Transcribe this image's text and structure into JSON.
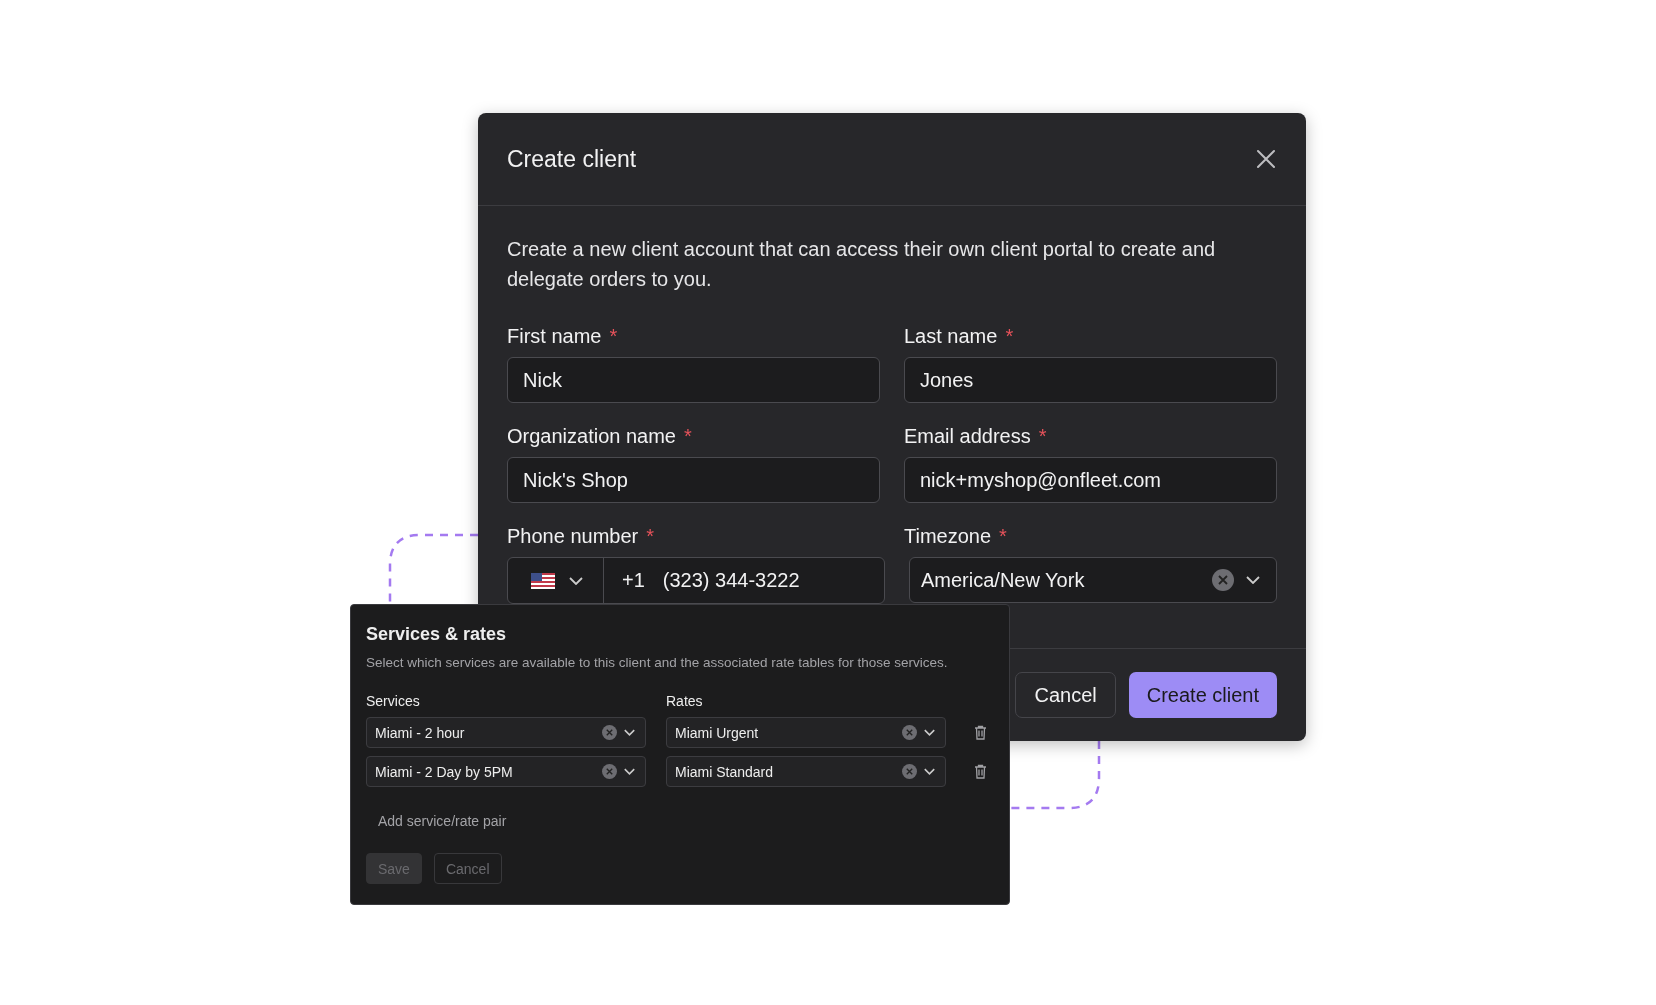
{
  "dialog": {
    "title": "Create client",
    "description": "Create a new client account that can access their own client portal to create and delegate orders to you.",
    "fields": [
      {
        "kind": "text",
        "label": "First name",
        "required_mark": "*",
        "value": "Nick"
      },
      {
        "kind": "text",
        "label": "Last name",
        "required_mark": "*",
        "value": "Jones"
      },
      {
        "kind": "text",
        "label": "Organization name",
        "required_mark": "*",
        "value": "Nick's Shop"
      },
      {
        "kind": "text",
        "label": "Email address",
        "required_mark": "*",
        "value": "nick+myshop@onfleet.com"
      },
      {
        "kind": "phone",
        "label": "Phone number",
        "required_mark": "*",
        "country_code": "+1",
        "value": "(323) 344-3222"
      },
      {
        "kind": "select",
        "label": "Timezone",
        "required_mark": "*",
        "value": "America/New York"
      }
    ],
    "buttons": [
      {
        "kind": "secondary",
        "label": "Cancel"
      },
      {
        "kind": "primary",
        "label": "Create client"
      }
    ]
  },
  "services_panel": {
    "title": "Services & rates",
    "description": "Select which services are available to this client and the associated rate tables for those services.",
    "columns": [
      "Services",
      "Rates"
    ],
    "rows": [
      {
        "service": "Miami - 2 hour",
        "rate": "Miami Urgent"
      },
      {
        "service": "Miami - 2 Day by 5PM",
        "rate": "Miami Standard"
      }
    ],
    "add_label": "Add service/rate pair",
    "buttons": [
      {
        "kind": "primary",
        "label": "Save",
        "disabled": true
      },
      {
        "kind": "secondary",
        "label": "Cancel",
        "disabled": true
      }
    ]
  }
}
